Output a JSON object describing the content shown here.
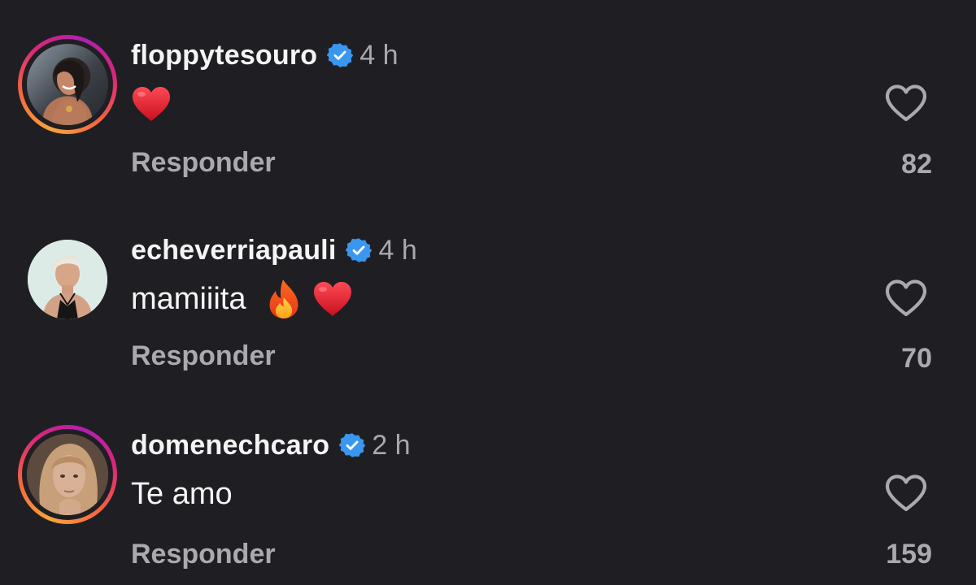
{
  "comments": [
    {
      "username": "floppytesouro",
      "time": "4 h",
      "text": "",
      "emojis": [
        "red-heart"
      ],
      "reply_label": "Responder",
      "likes": "82",
      "has_story_ring": true,
      "verified": true
    },
    {
      "username": "echeverriapauli",
      "time": "4 h",
      "text": "mamiiita",
      "emojis": [
        "fire",
        "red-heart"
      ],
      "reply_label": "Responder",
      "likes": "70",
      "has_story_ring": false,
      "verified": true
    },
    {
      "username": "domenechcaro",
      "time": "2 h",
      "text": "Te amo",
      "emojis": [],
      "reply_label": "Responder",
      "likes": "159",
      "has_story_ring": true,
      "verified": true
    }
  ],
  "colors": {
    "background": "#1f1f23",
    "verified_badge": "#3a97f0",
    "secondary_text": "#a9a9ae",
    "heart_emoji": "#e0182d"
  },
  "icons": [
    "verified-badge-icon",
    "like-heart-icon",
    "red-heart-emoji",
    "fire-emoji"
  ]
}
